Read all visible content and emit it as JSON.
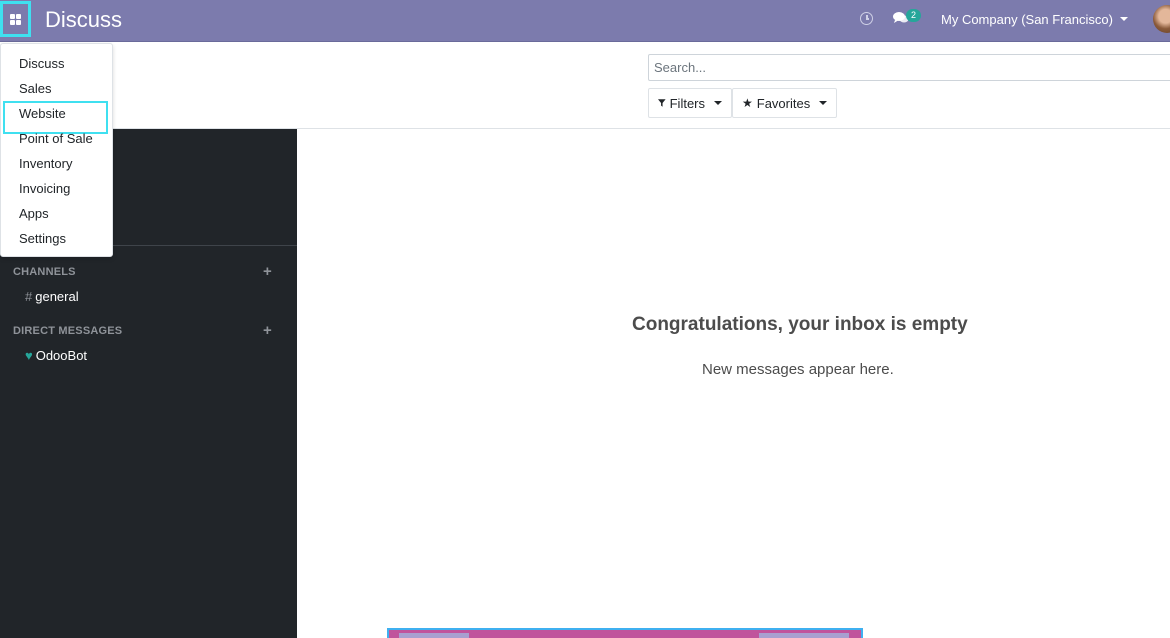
{
  "navbar": {
    "title": "Discuss",
    "chat_badge": "2",
    "company": "My Company (San Francisco)"
  },
  "control_panel": {
    "search_placeholder": "Search...",
    "filters_label": "Filters",
    "favorites_label": "Favorites"
  },
  "apps_menu": {
    "items": [
      {
        "label": "Discuss"
      },
      {
        "label": "Sales"
      },
      {
        "label": "Website"
      },
      {
        "label": "Point of Sale"
      },
      {
        "label": "Inventory"
      },
      {
        "label": "Invoicing"
      },
      {
        "label": "Apps"
      },
      {
        "label": "Settings"
      }
    ]
  },
  "sidebar": {
    "channels_title": "CHANNELS",
    "channels": [
      {
        "name": "general"
      }
    ],
    "dm_title": "DIRECT MESSAGES",
    "direct_messages": [
      {
        "name": "OdooBot"
      }
    ]
  },
  "main": {
    "empty_title": "Congratulations, your inbox is empty",
    "empty_subtitle": "New messages appear here."
  },
  "colors": {
    "navbar": "#7c7bad",
    "sidebar": "#212529",
    "highlight": "#3fe0f0",
    "online": "#26a69a"
  }
}
